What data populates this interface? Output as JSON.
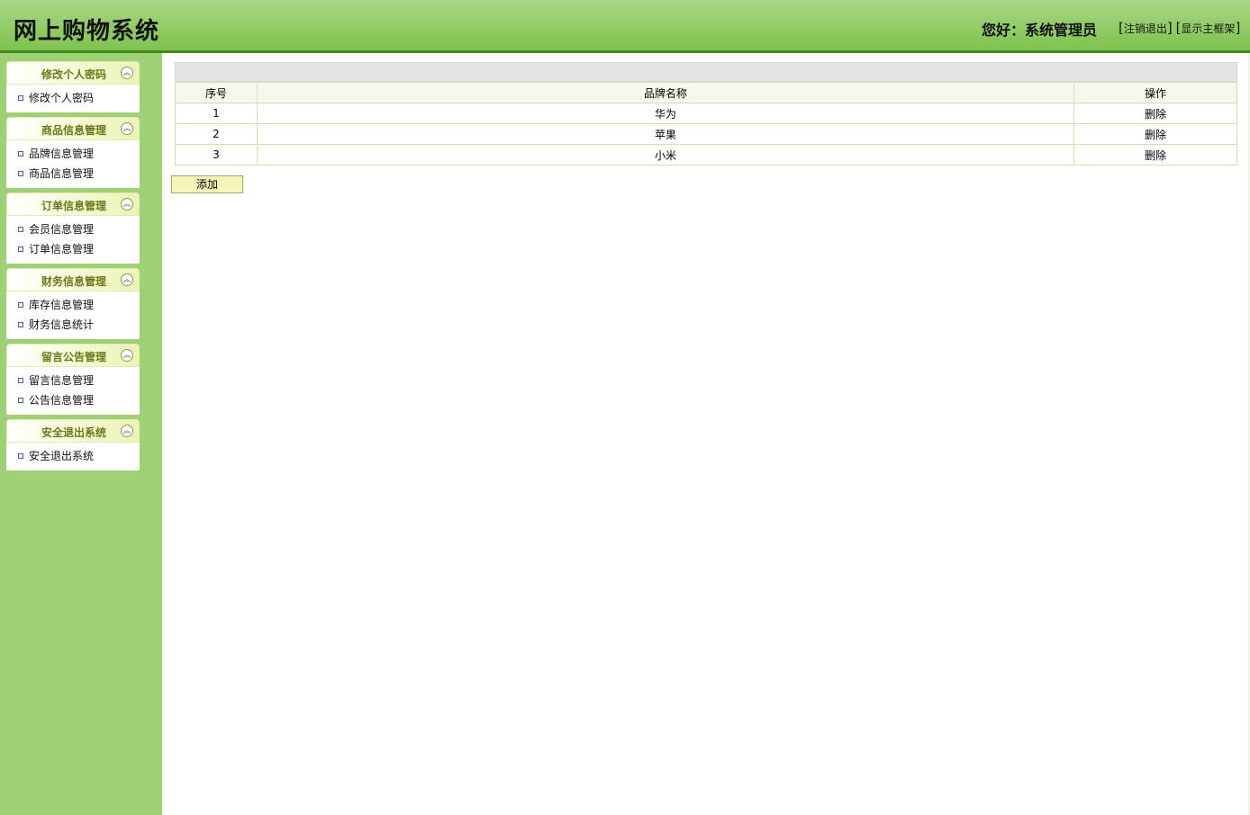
{
  "header": {
    "title": "网上购物系统",
    "greeting": "您好：系统管理员",
    "logout_label": "注销退出",
    "show_frame_label": "显示主框架"
  },
  "sidebar": {
    "panels": [
      {
        "title": "修改个人密码",
        "items": [
          "修改个人密码"
        ]
      },
      {
        "title": "商品信息管理",
        "items": [
          "品牌信息管理",
          "商品信息管理"
        ]
      },
      {
        "title": "订单信息管理",
        "items": [
          "会员信息管理",
          "订单信息管理"
        ]
      },
      {
        "title": "财务信息管理",
        "items": [
          "库存信息管理",
          "财务信息统计"
        ]
      },
      {
        "title": "留言公告管理",
        "items": [
          "留言信息管理",
          "公告信息管理"
        ]
      },
      {
        "title": "安全退出系统",
        "items": [
          "安全退出系统"
        ]
      }
    ]
  },
  "table": {
    "columns": [
      "序号",
      "品牌名称",
      "操作"
    ],
    "rows": [
      {
        "id": "1",
        "name": "华为",
        "action": "删除"
      },
      {
        "id": "2",
        "name": "苹果",
        "action": "删除"
      },
      {
        "id": "3",
        "name": "小米",
        "action": "删除"
      }
    ]
  },
  "add_button": "添加",
  "colors": {
    "header_green": "#8fcb62",
    "sidebar_green": "#9ed076",
    "panel_title": "#6b7a18",
    "button_bg": "#f4f6b8"
  }
}
